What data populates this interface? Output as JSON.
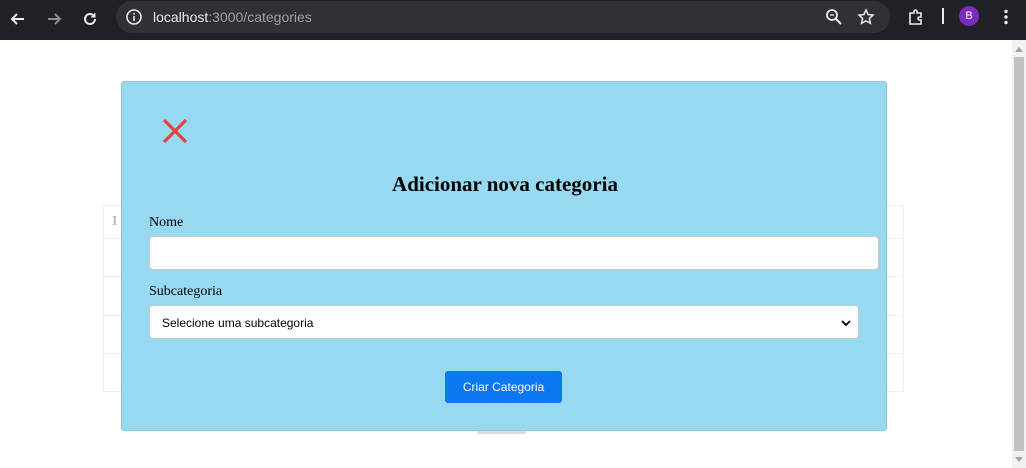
{
  "browser": {
    "url_host": "localhost",
    "url_path": ":3000/categories",
    "profile_initial": "B"
  },
  "page": {
    "table_header_fragment": "I"
  },
  "modal": {
    "title": "Adicionar nova categoria",
    "name_label": "Nome",
    "name_value": "",
    "subcategory_label": "Subcategoria",
    "subcategory_selected": "Selecione uma subcategoria",
    "submit_label": "Criar Categoria"
  },
  "colors": {
    "modal_bg": "#97d9f1",
    "close_icon": "#e2443f",
    "submit_bg": "#0b78f2"
  }
}
